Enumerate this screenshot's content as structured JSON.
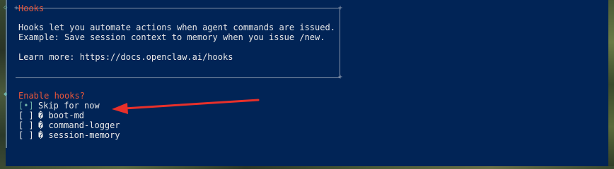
{
  "note": {
    "title": "Hooks",
    "line1": "Hooks let you automate actions when agent commands are issued.",
    "line2": "Example: Save session context to memory when you issue /new.",
    "line3": "Learn more: https://docs.openclaw.ai/hooks"
  },
  "prompt": {
    "question": "Enable hooks?",
    "options": [
      {
        "checkbox": "[•]",
        "label": "Skip for now",
        "selected": true
      },
      {
        "checkbox": "[ ]",
        "label": "� boot-md",
        "selected": false
      },
      {
        "checkbox": "[ ]",
        "label": "� command-logger",
        "selected": false
      },
      {
        "checkbox": "[ ]",
        "label": "� session-memory",
        "selected": false
      }
    ]
  },
  "colors": {
    "terminal_bg": "#012456",
    "title": "#e8563a",
    "text": "#e8e8e8",
    "selected_marker": "#6fb1a8",
    "annotation_arrow": "#e8302a"
  },
  "icons": {
    "active_step": "diamond-icon",
    "option_icon": "replacement-char-icon",
    "annotation": "red-arrow-icon"
  }
}
